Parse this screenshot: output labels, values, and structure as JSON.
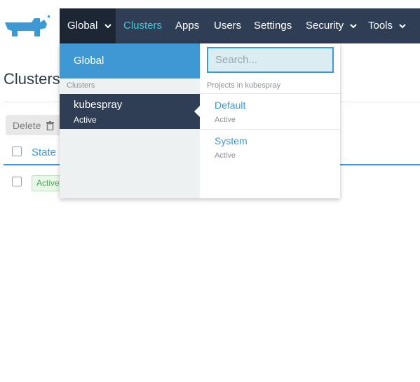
{
  "nav": {
    "logo": "rancher-logo",
    "global": "Global",
    "items": [
      "Clusters",
      "Apps",
      "Users",
      "Settings",
      "Security",
      "Tools"
    ],
    "colors": {
      "bar": "#2f3e54",
      "active_item": "#4cc6da",
      "logo": "#3d98d3"
    }
  },
  "page": {
    "title": "Clusters",
    "delete_label": "Delete",
    "state_header": "State",
    "row_state": "Active"
  },
  "dropdown": {
    "global_label": "Global",
    "clusters_heading": "Clusters",
    "clusters": [
      {
        "name": "kubespray",
        "status": "Active"
      }
    ],
    "search": {
      "placeholder": "Search...",
      "value": ""
    },
    "projects_heading": "Projects in kubespray",
    "projects": [
      {
        "name": "Default",
        "status": "Active"
      },
      {
        "name": "System",
        "status": "Active"
      }
    ]
  }
}
